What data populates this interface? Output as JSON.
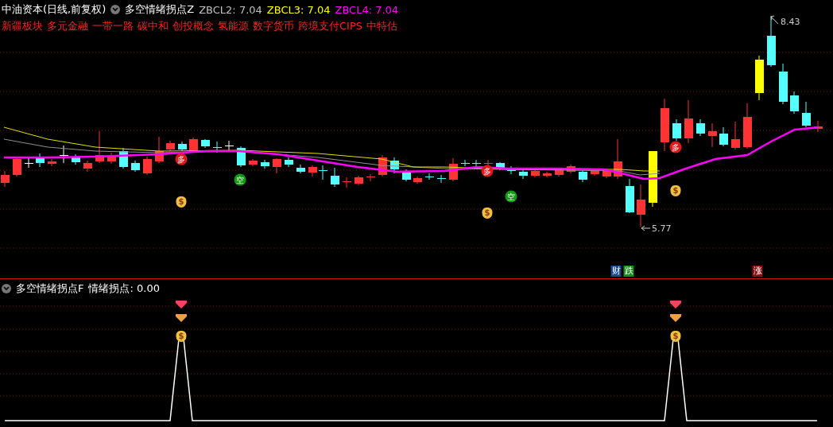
{
  "main_panel": {
    "title": "中油资本(日线,前复权)",
    "indicator": "多空情绪拐点Z",
    "readouts": [
      {
        "label": "ZBCL2: 7.04",
        "color": "#c0c0c0"
      },
      {
        "label": "ZBCL3: 7.04",
        "color": "#ffff00"
      },
      {
        "label": "ZBCL4: 7.04",
        "color": "#ff00ff"
      }
    ],
    "concepts": [
      "新疆板块",
      "多元金融",
      "一带一路",
      "碳中和",
      "创投概念",
      "氢能源",
      "数字货币",
      "跨境支付CIPS",
      "中特估"
    ],
    "high_label": "8.43",
    "low_label": "5.77",
    "markers": [
      {
        "kind": "long",
        "label": "多"
      },
      {
        "kind": "short",
        "label": "空"
      },
      {
        "kind": "bag",
        "label": "$"
      },
      {
        "kind": "long",
        "label": "多"
      },
      {
        "kind": "short",
        "label": "空"
      },
      {
        "kind": "bag",
        "label": "$"
      },
      {
        "kind": "long",
        "label": "多"
      },
      {
        "kind": "bag",
        "label": "$"
      }
    ],
    "signal_tags": [
      {
        "label": "财",
        "color": "#1a4a8a"
      },
      {
        "label": "跌",
        "color": "#1a8a1a"
      },
      {
        "label": "涨",
        "color": "#8a1010"
      }
    ]
  },
  "sub_panel": {
    "indicator": "多空情绪拐点F",
    "readout": "情绪拐点: 0.00",
    "peaks": [
      {
        "label": "$"
      },
      {
        "label": "$"
      }
    ]
  }
}
